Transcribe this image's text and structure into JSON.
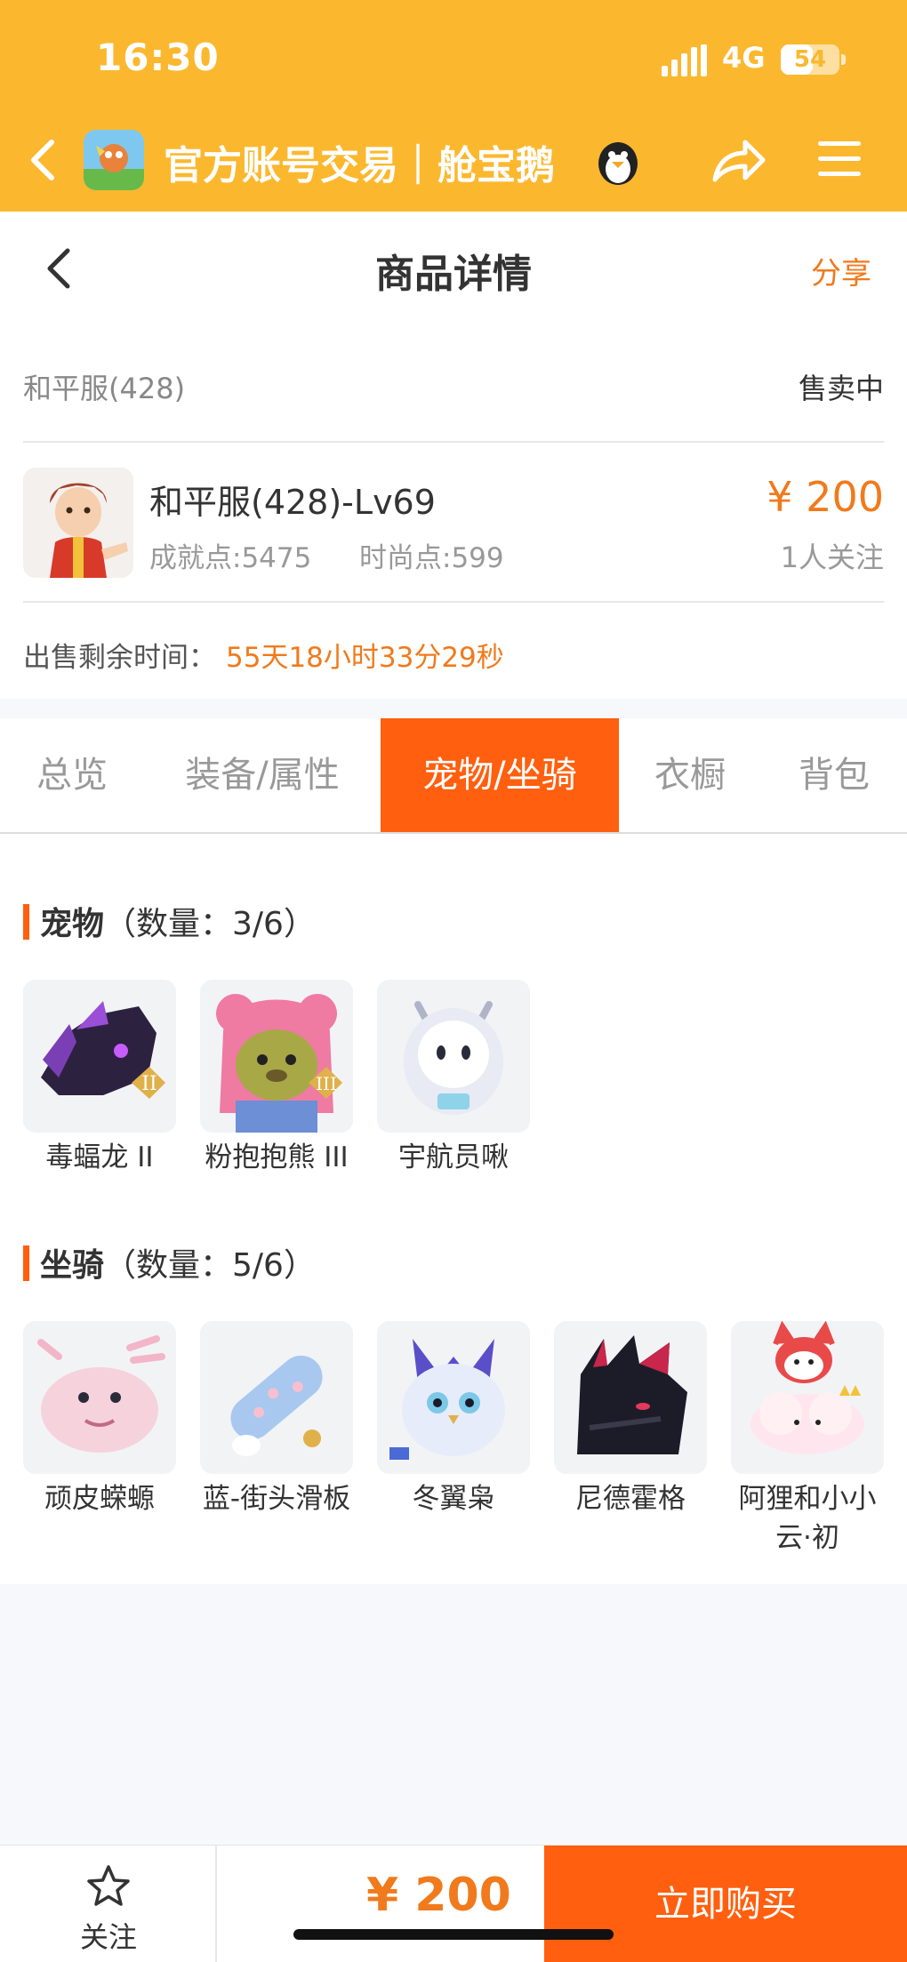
{
  "status_bar": {
    "time": "16:30",
    "network": "4G",
    "battery": "54",
    "battery_level": 0.54
  },
  "app_header": {
    "title": "官方账号交易｜舱宝鹅"
  },
  "page_header": {
    "title": "商品详情",
    "share": "分享"
  },
  "listing": {
    "server": "和平服(428)",
    "status": "售卖中",
    "character": "和平服(428)-Lv69",
    "achievement": "成就点:5475",
    "fashion": "时尚点:599",
    "price": "¥ 200",
    "watchers": "1人关注",
    "remaining_label": "出售剩余时间：",
    "remaining_value": "55天18小时33分29秒"
  },
  "tabs": [
    "总览",
    "装备/属性",
    "宠物/坐骑",
    "衣橱",
    "背包"
  ],
  "active_tab": "宠物/坐骑",
  "pets": {
    "title": "宠物",
    "count": "（数量：3/6）",
    "items": [
      {
        "name": "毒蝠龙 II",
        "icon": "dragon-pet-icon"
      },
      {
        "name": "粉抱抱熊 III",
        "icon": "bear-pet-icon"
      },
      {
        "name": "宇航员啾",
        "icon": "astronaut-pet-icon"
      }
    ]
  },
  "mounts": {
    "title": "坐骑",
    "count": "（数量：5/6）",
    "items": [
      {
        "name": "顽皮蝾螈",
        "icon": "axolotl-mount-icon"
      },
      {
        "name": "蓝-街头滑板",
        "icon": "skateboard-mount-icon"
      },
      {
        "name": "冬翼枭",
        "icon": "owl-mount-icon"
      },
      {
        "name": "尼德霍格",
        "icon": "black-dragon-mount-icon"
      },
      {
        "name": "阿狸和小小云·初",
        "icon": "fox-cloud-mount-icon"
      }
    ]
  },
  "bottom_bar": {
    "favorite": "关注",
    "price": "¥ 200",
    "buy": "立即购买"
  },
  "colors": {
    "header": "#fbb82f",
    "accent": "#ff5f0f",
    "price": "#f07a1c"
  }
}
